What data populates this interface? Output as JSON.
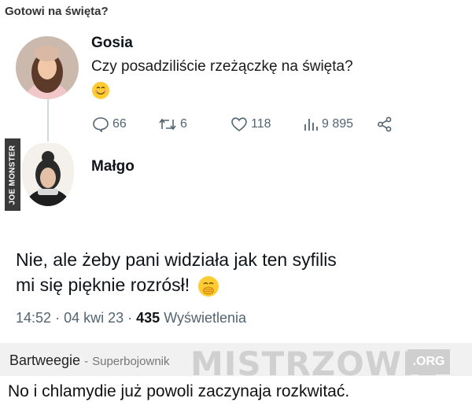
{
  "page": {
    "title": "Gotowi na święta?"
  },
  "watermark_side": "JOE MONSTER",
  "tweet1": {
    "author": "Gosia",
    "text": "Czy posadziliście rzeżączkę na święta?",
    "emoji": "smiling-face",
    "replies": "66",
    "retweets": "6",
    "likes": "118",
    "views": "9 895"
  },
  "tweet2": {
    "author": "Małgo",
    "text_line1": "Nie, ale żeby pani widziała jak ten syfilis",
    "text_line2": "mi się pięknie rozrósł!",
    "emoji": "face-with-hand-over-mouth",
    "time": "14:52",
    "date": "04 kwi 23",
    "views_count": "435",
    "views_label": "Wyświetlenia"
  },
  "comment": {
    "user": "Bartweegie",
    "separator": "-",
    "rank": "Superbojownik",
    "text": "No i chlamydie już powoli zaczynaja rozkwitać."
  },
  "site_watermark": {
    "name": "MISTRZOWIE",
    "tld": ".ORG"
  },
  "colors": {
    "muted": "#536471",
    "emoji": "#ffcc33",
    "line": "#cfd9de"
  }
}
